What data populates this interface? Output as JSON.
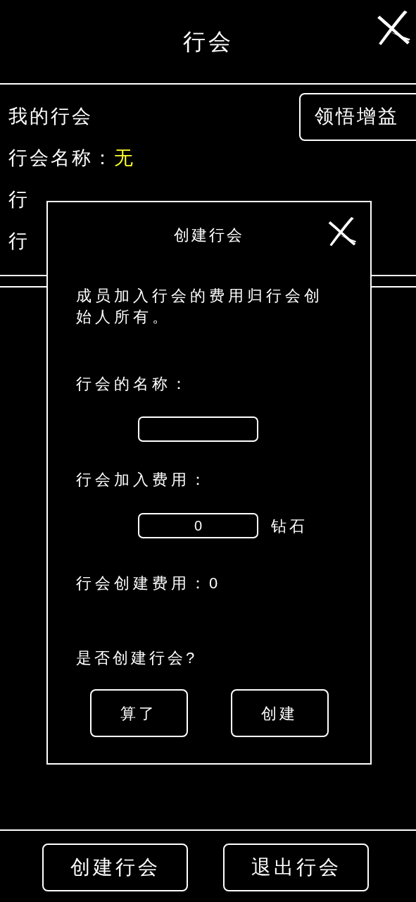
{
  "header": {
    "title": "行会"
  },
  "section": {
    "heading": "我的行会",
    "action_button": "领悟增益",
    "rows": [
      {
        "label": "行会名称：",
        "value": "无"
      },
      {
        "label": "行"
      },
      {
        "label": "行"
      }
    ]
  },
  "dialog": {
    "title": "创建行会",
    "description": "成员加入行会的费用归行会创始人所有。",
    "fields": [
      {
        "label": "行会的名称："
      },
      {
        "label": "行会加入费用：",
        "value": "0",
        "unit": "钻石"
      }
    ],
    "cost": {
      "label": "行会创建费用：",
      "value": "0"
    },
    "question": "是否创建行会?",
    "buttons": [
      "算了",
      "创建"
    ]
  },
  "footer_buttons": [
    "创建行会",
    "退出行会"
  ]
}
